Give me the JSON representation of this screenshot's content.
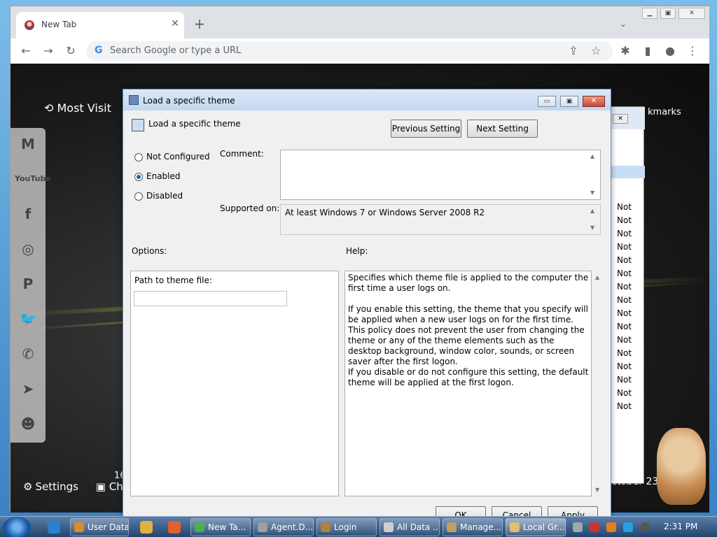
{
  "browser": {
    "tab_title": "New Tab",
    "tab_close": "✕",
    "new_tab": "+",
    "tab_search": "⌄",
    "omnibox_placeholder": "Search Google or type a URL",
    "g_icon": "G",
    "back": "←",
    "forward": "→",
    "reload": "↻",
    "share": "⇪",
    "star": "☆",
    "extensions": "✱",
    "sidepanel": "▮",
    "profile": "●",
    "menu": "⋮"
  },
  "new_tab_page": {
    "most_visited": "Most Visit",
    "bookmarks": "kmarks",
    "settings": "Settings",
    "date": "ctober 23,",
    "partial_left": "16",
    "partial_ch": "Ch"
  },
  "social_icons": [
    {
      "name": "gmail",
      "glyph": "M"
    },
    {
      "name": "youtube",
      "glyph": "YouTube"
    },
    {
      "name": "facebook",
      "glyph": "f"
    },
    {
      "name": "instagram",
      "glyph": "◎"
    },
    {
      "name": "pinterest",
      "glyph": "P"
    },
    {
      "name": "twitter",
      "glyph": "🐦"
    },
    {
      "name": "whatsapp",
      "glyph": "✆"
    },
    {
      "name": "telegram",
      "glyph": "➤"
    },
    {
      "name": "reddit",
      "glyph": "☻"
    }
  ],
  "background_window": {
    "rows": [
      "Not",
      "Not",
      "Not",
      "Not",
      "Not",
      "Not",
      "Not",
      "Not",
      "Not",
      "Not",
      "Not",
      "Not",
      "Not",
      "Not",
      "Not",
      "Not"
    ]
  },
  "dialog": {
    "title": "Load a specific theme",
    "policy_name": "Load a specific theme",
    "prev_setting": "Previous Setting",
    "next_setting": "Next Setting",
    "radio": {
      "not_configured": "Not Configured",
      "enabled": "Enabled",
      "disabled": "Disabled"
    },
    "comment_label": "Comment:",
    "supported_label": "Supported on:",
    "supported_value": "At least Windows 7 or Windows Server 2008 R2",
    "options_label": "Options:",
    "help_label": "Help:",
    "path_label": "Path to theme file:",
    "path_value": "",
    "help_paragraphs": [
      "Specifies which theme file is applied to the computer the first time a user logs on.",
      "If you enable this setting, the theme that you specify will be applied when a new user logs on for the first time.  This policy does not prevent the user from changing the theme or any of the theme elements such as the desktop background, window color, sounds, or screen saver after the first logon.",
      "If you disable or do not configure this setting, the default theme will be applied at the first logon."
    ],
    "ok": "OK",
    "cancel": "Cancel",
    "apply": "Apply",
    "minimize": "▭",
    "maximize": "▣",
    "close": "✕"
  },
  "taskbar": {
    "items": [
      {
        "label": "User Data",
        "color": "#d98c2b"
      },
      {
        "label": "New Ta...",
        "color": "#4caf50"
      },
      {
        "label": "Agent.D...",
        "color": "#9e9e9e"
      },
      {
        "label": "Login",
        "color": "#b08040"
      },
      {
        "label": "All Data ...",
        "color": "#cfcfcf"
      },
      {
        "label": "Manage...",
        "color": "#c0a060"
      },
      {
        "label": "Local Gr...",
        "color": "#e0c070"
      }
    ],
    "clock": "2:31 PM"
  }
}
